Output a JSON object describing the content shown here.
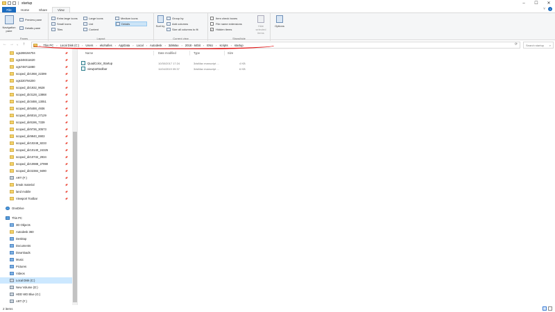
{
  "window": {
    "title": "startup",
    "minimize": "–",
    "maximize": "☐",
    "close": "✕"
  },
  "ribbon_tabs": [
    "File",
    "Home",
    "Share",
    "View"
  ],
  "ribbon": {
    "panes": {
      "label": "Panes",
      "navigation_pane": "Navigation pane",
      "preview_pane": "Preview pane",
      "details_pane": "Details pane"
    },
    "layout": {
      "label": "Layout",
      "extra_large_icons": "Extra large icons",
      "large_icons": "Large icons",
      "medium_icons": "Medium icons",
      "small_icons": "Small icons",
      "list": "List",
      "details": "Details",
      "tiles": "Tiles",
      "content": "Content"
    },
    "current_view": {
      "label": "Current view",
      "sort_by": "Sort by",
      "group_by": "Group by",
      "add_columns": "Add columns",
      "size_all_columns": "Size all columns to fit"
    },
    "show_hide": {
      "label": "Show/hide",
      "item_check_boxes": "Item check boxes",
      "file_name_extensions": "File name extensions",
      "hidden_items": "Hidden items",
      "hidden_items_checked": true,
      "hide_selected_items": "Hide selected items"
    },
    "options": "Options"
  },
  "address": {
    "crumbs": [
      "This PC",
      "Local Disk (C:)",
      "Users",
      "ekohafies",
      "AppData",
      "Local",
      "Autodesk",
      "3dsMax",
      "2018 - 64bit",
      "ENU",
      "scripts",
      "startup"
    ],
    "search_placeholder": "Search startup"
  },
  "nav": {
    "quick_access": [
      "ogs288194704",
      "ogs348311620",
      "ogs748711880",
      "scoped_dir1068_22399",
      "ogs320794200",
      "scoped_dir1932_9628",
      "scoped_dir3128_13868",
      "scoped_dir3488_13051",
      "scoped_dir5488_4936",
      "scoped_dir6016_27129",
      "scoped_dir8196_7339",
      "scoped_dir9736_30573",
      "scoped_dir9940_8903",
      "scoped_dir10248_8233",
      "scoped_dir10140_24325",
      "scoped_dir10732_2934",
      "scoped_dir10988_27990",
      "scoped_dir22384_9490",
      "ART (F:)",
      "break material",
      "land mobile",
      "Viewport Toolbar"
    ],
    "onedrive": "OneDrive",
    "this_pc": "This PC",
    "this_pc_children": [
      "3D Objects",
      "Autodesk 360",
      "Desktop",
      "Documents",
      "Downloads",
      "Music",
      "Pictures",
      "Videos",
      "Local Disk (C:)",
      "New Volume (D:)",
      "HDD WD Blue (G:)",
      "ART (F:)"
    ]
  },
  "columns": {
    "name": "Name",
    "date_modified": "Date modified",
    "type": "Type",
    "size": "Size"
  },
  "files": [
    {
      "name": "QuadColor_Startup",
      "date": "10/30/2017 17:24",
      "type": "3dsMax maxscript ...",
      "size": "4 KB"
    },
    {
      "name": "viewporttoolbar",
      "date": "11/04/2019 09:37",
      "type": "3dsMax maxscript ...",
      "size": "6 KB"
    }
  ],
  "status": {
    "item_count": "2 items"
  },
  "colors": {
    "accent": "#1a6bbf",
    "annotation_red": "#e41c1c",
    "folder": "#f3d36b",
    "selection": "#cce8ff"
  }
}
